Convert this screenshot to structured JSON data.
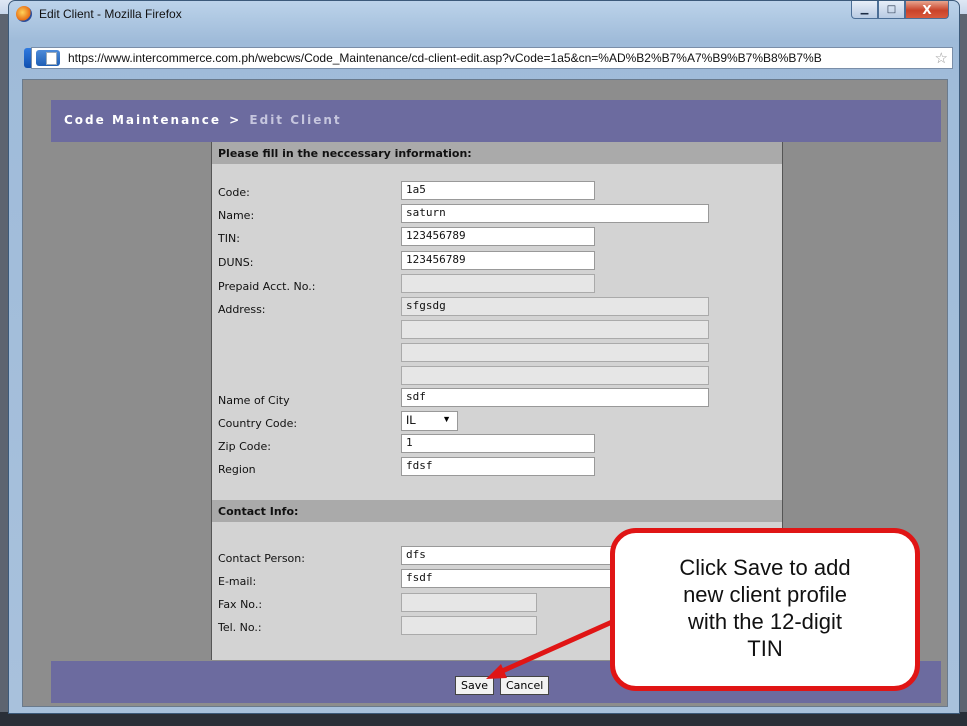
{
  "window": {
    "title": "Edit Client - Mozilla Firefox",
    "url": "https://www.intercommerce.com.ph/webcws/Code_Maintenance/cd-client-edit.asp?vCode=1a5&cn=%AD%B2%B7%A7%B9%B7%B8%B7%B",
    "controls": {
      "minimize": "▁",
      "maximize": "□",
      "close": "X"
    }
  },
  "breadcrumb": {
    "parent": "Code Maintenance",
    "separator": ">",
    "current": "Edit Client"
  },
  "form": {
    "section_main": "Please fill in the neccessary information:",
    "labels": {
      "code": "Code:",
      "name": "Name:",
      "tin": "TIN:",
      "duns": "DUNS:",
      "prepaid": "Prepaid Acct. No.:",
      "address": "Address:",
      "city": "Name of City",
      "country": "Country Code:",
      "zip": "Zip Code:",
      "region": "Region"
    },
    "values": {
      "code": "1a5",
      "name": "saturn",
      "tin": "123456789",
      "duns": "123456789",
      "prepaid": "",
      "address1": "sfgsdg",
      "address2": "",
      "address3": "",
      "address4": "",
      "city": "sdf",
      "country": "IL",
      "zip": "1",
      "region": "fdsf"
    },
    "section_contact": "Contact Info:",
    "contact_labels": {
      "person": "Contact Person:",
      "email": "E-mail:",
      "fax": "Fax No.:",
      "tel": "Tel. No.:"
    },
    "contact_values": {
      "person": "dfs",
      "email": "fsdf",
      "fax": "",
      "tel": ""
    }
  },
  "buttons": {
    "save": "Save",
    "cancel": "Cancel"
  },
  "callout": {
    "text": "Click Save to add\nnew client profile\nwith the 12-digit\nTIN",
    "border_color": "#e01515"
  },
  "icons": [
    "firefox-icon",
    "page-favicon-icon",
    "bookmark-star-icon",
    "dropdown-arrow-icon"
  ]
}
